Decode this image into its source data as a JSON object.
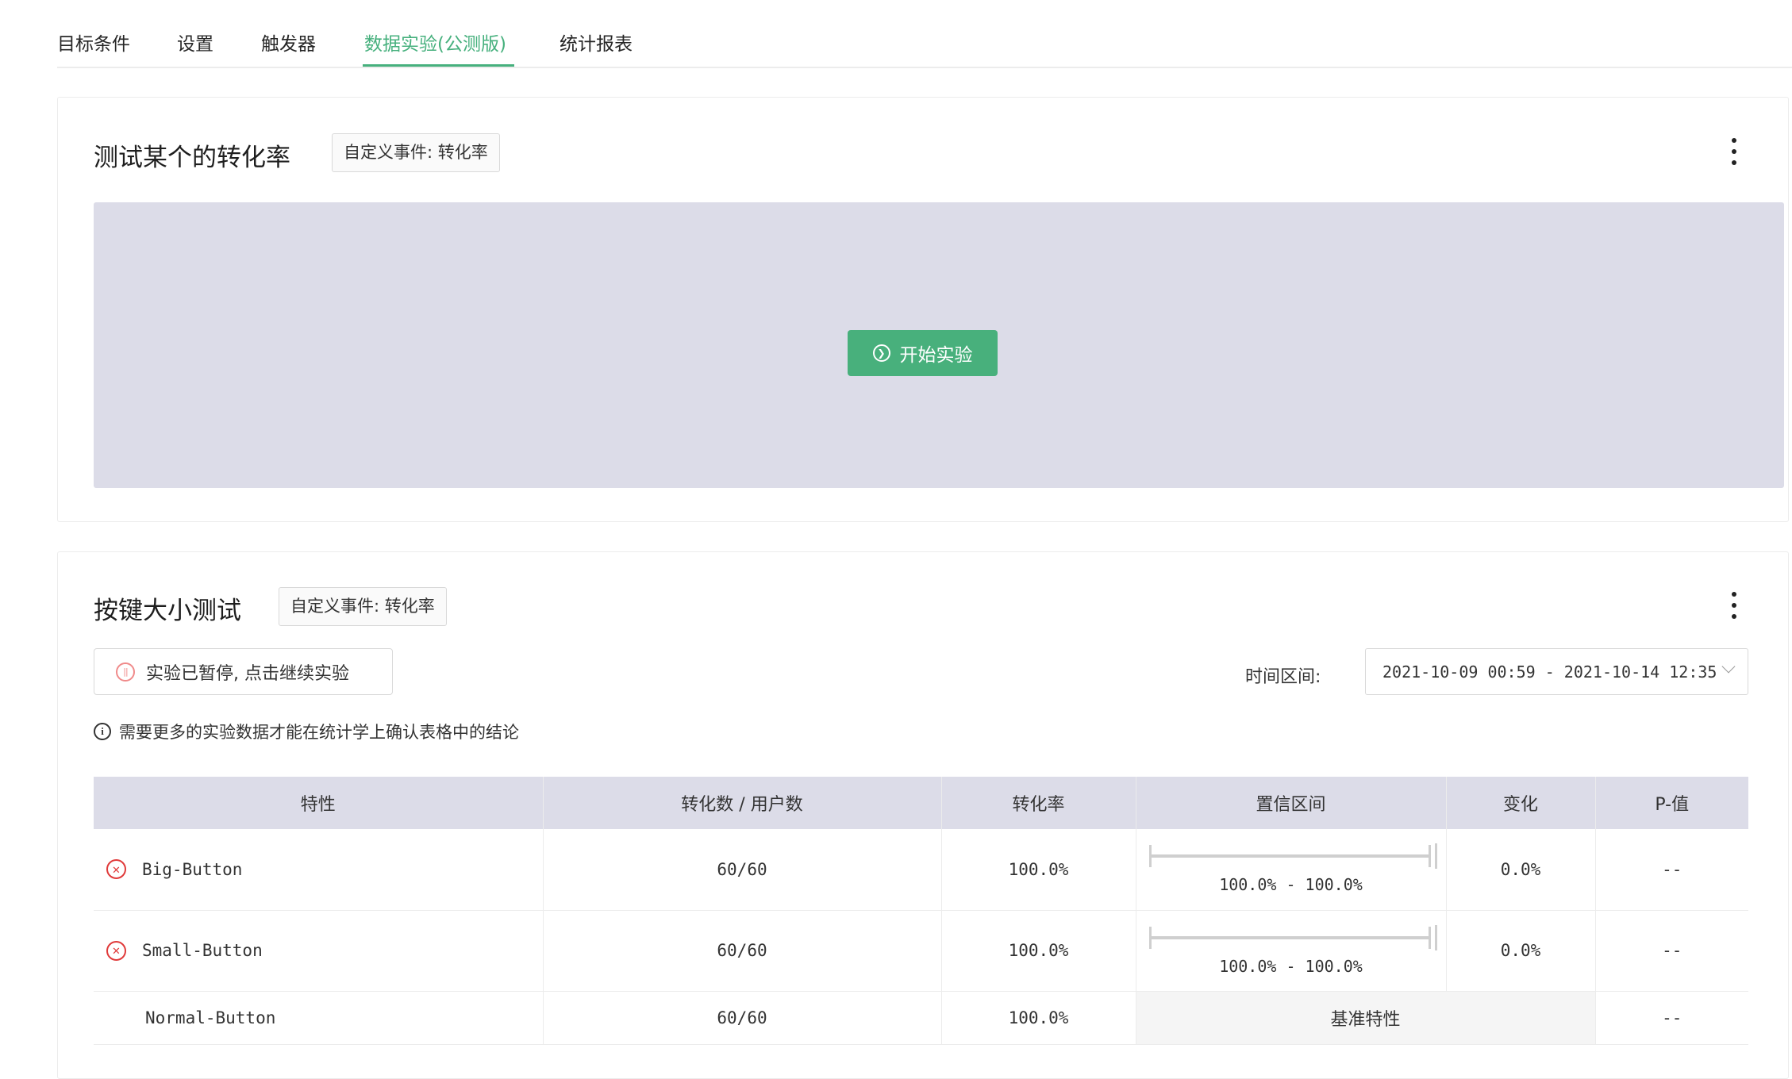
{
  "tabs": [
    {
      "label": "目标条件"
    },
    {
      "label": "设置"
    },
    {
      "label": "触发器"
    },
    {
      "label": "数据实验(公测版)",
      "active": true
    },
    {
      "label": "统计报表"
    }
  ],
  "experiment1": {
    "title": "测试某个的转化率",
    "tag": "自定义事件: 转化率",
    "start_button": "开始实验"
  },
  "experiment2": {
    "title": "按键大小测试",
    "tag": "自定义事件: 转化率",
    "paused_button": "实验已暂停, 点击继续实验",
    "time_label": "时间区间:",
    "date_range": "2021-10-09 00:59 - 2021-10-14 12:35",
    "notice": "需要更多的实验数据才能在统计学上确认表格中的结论",
    "table": {
      "headers": [
        "特性",
        "转化数 / 用户数",
        "转化率",
        "置信区间",
        "变化",
        "P-值"
      ],
      "rows": [
        {
          "name": "Big-Button",
          "conv": "60/60",
          "rate": "100.0%",
          "ci": "100.0% - 100.0%",
          "change": "0.0%",
          "p": "--"
        },
        {
          "name": "Small-Button",
          "conv": "60/60",
          "rate": "100.0%",
          "ci": "100.0% - 100.0%",
          "change": "0.0%",
          "p": "--"
        },
        {
          "name": "Normal-Button",
          "conv": "60/60",
          "rate": "100.0%",
          "baseline": "基准特性",
          "p": "--"
        }
      ]
    }
  },
  "colors": {
    "accent": "#46b07d",
    "placeholder_bg": "#dcdce8",
    "error": "#e03a3a",
    "paused": "#f08a8a"
  }
}
